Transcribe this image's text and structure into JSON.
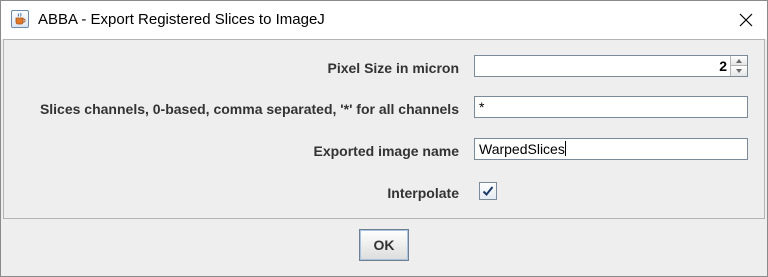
{
  "window": {
    "title": "ABBA - Export Registered Slices to ImageJ",
    "app_icon": "java-cup-icon",
    "close_icon": "close-icon"
  },
  "form": {
    "pixel_size": {
      "label": "Pixel Size in micron",
      "value": "2"
    },
    "slices_channels": {
      "label": "Slices channels, 0-based, comma separated, '*' for all channels",
      "value": "*"
    },
    "image_name": {
      "label": "Exported image name",
      "value": "WarpedSlices"
    },
    "interpolate": {
      "label": "Interpolate",
      "checked": true
    }
  },
  "buttons": {
    "ok_label": "OK"
  },
  "colors": {
    "dialog_background": "#eeeeee",
    "titlebar_background": "#ffffff",
    "label_text": "#333333"
  }
}
